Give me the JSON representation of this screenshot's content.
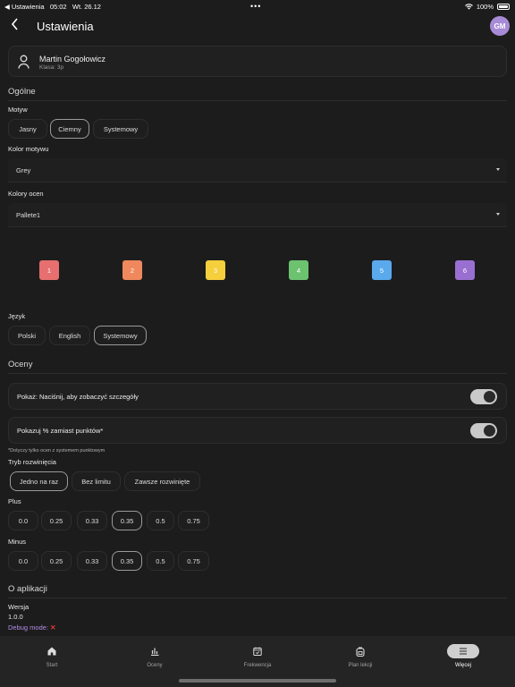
{
  "status_bar": {
    "back_app": "◀ Ustawienia",
    "time": "05:02",
    "date": "Wt. 26.12",
    "dots": "•••",
    "battery": "100%"
  },
  "header": {
    "title": "Ustawienia",
    "avatar_initials": "GM",
    "avatar_color": "#a78bd6"
  },
  "profile": {
    "name": "Martin Gogołowicz",
    "class": "Klasa: 3p"
  },
  "general": {
    "title": "Ogólne",
    "theme": {
      "label": "Motyw",
      "options": [
        "Jasny",
        "Ciemny",
        "Systemowy"
      ],
      "selected": "Ciemny"
    },
    "theme_color": {
      "label": "Kolor motywu",
      "value": "Grey"
    },
    "grade_colors": {
      "label": "Kolory ocen",
      "value": "Pallete1",
      "grades": [
        {
          "label": "1",
          "color": "#e76f6f"
        },
        {
          "label": "2",
          "color": "#f0885e"
        },
        {
          "label": "3",
          "color": "#f5cf3c"
        },
        {
          "label": "4",
          "color": "#6cc26f"
        },
        {
          "label": "5",
          "color": "#5aa9ec"
        },
        {
          "label": "6",
          "color": "#9a6fd2"
        }
      ]
    },
    "language": {
      "label": "Język",
      "options": [
        "Polski",
        "English",
        "Systemowy"
      ],
      "selected": "Systemowy"
    }
  },
  "grades": {
    "title": "Oceny",
    "show_tap": {
      "label": "Pokaż: Naciśnij, aby zobaczyć szczegóły",
      "enabled": true
    },
    "show_percent": {
      "label": "Pokazuj % zamiast punktów*",
      "enabled": true
    },
    "note": "*Dotyczy tylko ocen z systemem punktowym",
    "expand_mode": {
      "label": "Tryb rozwinięcia",
      "options": [
        "Jedno na raz",
        "Bez limitu",
        "Zawsze rozwinięte"
      ],
      "selected": "Jedno na raz"
    },
    "plus": {
      "label": "Plus",
      "options": [
        "0.0",
        "0.25",
        "0.33",
        "0.35",
        "0.5",
        "0.75"
      ],
      "selected": "0.35"
    },
    "minus": {
      "label": "Minus",
      "options": [
        "0.0",
        "0.25",
        "0.33",
        "0.35",
        "0.5",
        "0.75"
      ],
      "selected": "0.35"
    }
  },
  "about": {
    "title": "O aplikacji",
    "version_label": "Wersja",
    "version": "1.0.0",
    "debug_label": "Debug mode:",
    "debug_value": "✕"
  },
  "nav": {
    "items": [
      {
        "label": "Start",
        "icon": "home-icon"
      },
      {
        "label": "Oceny",
        "icon": "chart-icon"
      },
      {
        "label": "Frekwencja",
        "icon": "calendar-icon"
      },
      {
        "label": "Plan lekcji",
        "icon": "backpack-icon"
      },
      {
        "label": "Więcej",
        "icon": "menu-icon"
      }
    ],
    "active": "Więcej"
  }
}
